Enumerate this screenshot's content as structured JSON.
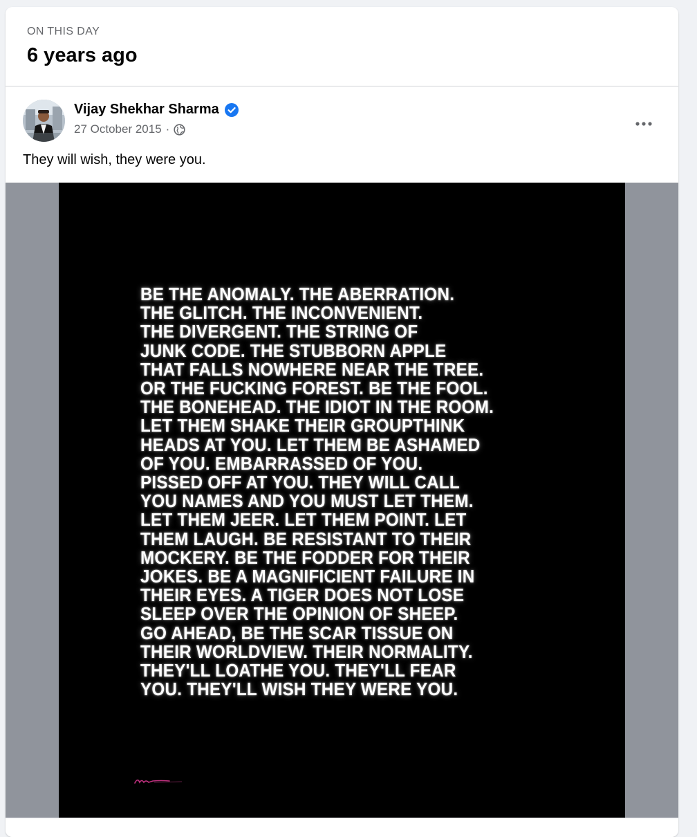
{
  "memory": {
    "label": "ON THIS DAY",
    "years_ago": "6 years ago"
  },
  "post": {
    "author": "Vijay Shekhar Sharma",
    "date": "27 October 2015",
    "separator": "·",
    "privacy_icon": "globe-icon",
    "verified_icon": "verified-badge-icon",
    "more_icon": "more-options-icon",
    "text": "They will wish, they were you."
  },
  "poster": {
    "lines": [
      "BE THE ANOMALY. THE ABERRATION.",
      "THE GLITCH. THE INCONVENIENT.",
      "THE DIVERGENT. THE STRING OF",
      "JUNK CODE. THE STUBBORN APPLE",
      "THAT FALLS NOWHERE NEAR THE TREE.",
      "OR THE FUCKING FOREST. BE THE FOOL.",
      "THE BONEHEAD. THE IDIOT IN THE ROOM.",
      "LET THEM SHAKE THEIR GROUPTHINK",
      "HEADS AT YOU. LET THEM BE ASHAMED",
      "OF YOU. EMBARRASSED OF YOU.",
      "PISSED OFF AT YOU. THEY WILL CALL",
      "YOU NAMES AND YOU MUST LET THEM.",
      "LET THEM JEER. LET THEM POINT. LET",
      "THEM LAUGH. BE RESISTANT TO THEIR",
      "MOCKERY. BE THE FODDER FOR THEIR",
      "JOKES. BE A MAGNIFICIENT FAILURE IN",
      "THEIR EYES. A TIGER DOES NOT LOSE",
      "SLEEP OVER THE OPINION OF SHEEP.",
      "GO AHEAD, BE THE SCAR TISSUE ON",
      "THEIR WORLDVIEW. THEIR NORMALITY.",
      "THEY'LL LOATHE YOU. THEY'LL FEAR",
      "YOU. THEY'LL WISH THEY WERE YOU."
    ]
  },
  "colors": {
    "accent_verified": "#1877f2",
    "secondary_text": "#65676b",
    "poster_background": "#000000",
    "media_side_bars": "#90949c"
  }
}
